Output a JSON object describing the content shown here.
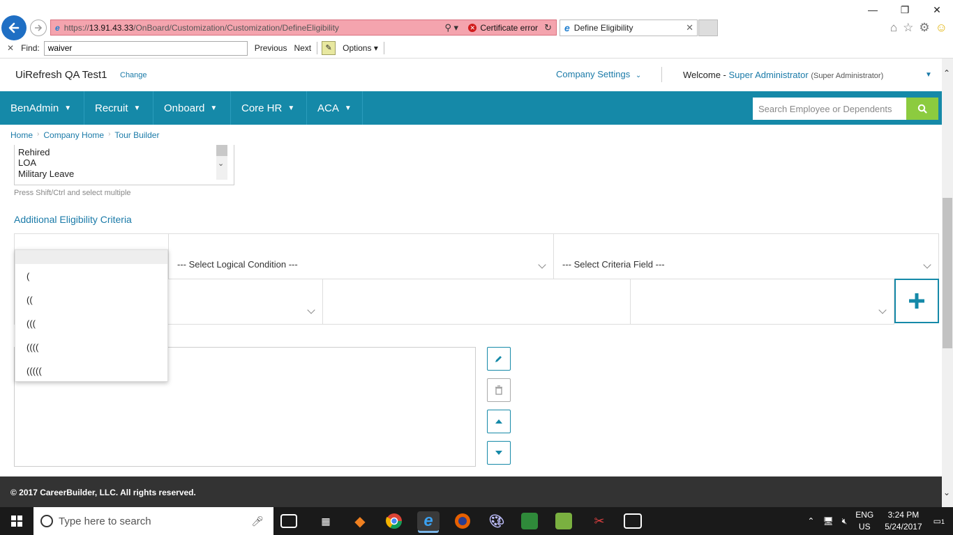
{
  "browser": {
    "url_prefix": "https://",
    "url_host": "13.91.43.33",
    "url_path": "/OnBoard/Customization/Customization/DefineEligibility",
    "cert_error": "Certificate error",
    "tab_title": "Define Eligibility",
    "find_label": "Find:",
    "find_value": "waiver",
    "find_previous": "Previous",
    "find_next": "Next",
    "find_options": "Options"
  },
  "header": {
    "company": "UiRefresh QA Test1",
    "change": "Change",
    "company_settings": "Company Settings",
    "welcome": "Welcome -",
    "user": "Super Administrator",
    "role": "(Super Administrator)"
  },
  "nav": {
    "items": [
      {
        "label": "BenAdmin"
      },
      {
        "label": "Recruit"
      },
      {
        "label": "Onboard"
      },
      {
        "label": "Core HR"
      },
      {
        "label": "ACA"
      }
    ],
    "search_placeholder": "Search Employee or Dependents"
  },
  "breadcrumb": [
    "Home",
    "Company Home",
    "Tour Builder"
  ],
  "status_options": [
    "Rehired",
    "LOA",
    "Military Leave"
  ],
  "hint": "Press Shift/Ctrl and select multiple",
  "section_title": "Additional Eligibility Criteria",
  "criteria": {
    "logical_placeholder": "--- Select Logical Condition ---",
    "field_placeholder": "--- Select Criteria Field ---"
  },
  "paren_options": [
    "(",
    "((",
    "(((",
    "((((",
    "((((("
  ],
  "footer": "© 2017 CareerBuilder, LLC. All rights reserved.",
  "taskbar": {
    "search_placeholder": "Type here to search",
    "lang1": "ENG",
    "lang2": "US",
    "time": "3:24 PM",
    "date": "5/24/2017",
    "notif_count": "1"
  },
  "colors": {
    "nav_bg": "#1589a8",
    "link": "#1a7aa8",
    "search_btn": "#8ccb3f",
    "addr_error": "#f4a4ae"
  }
}
